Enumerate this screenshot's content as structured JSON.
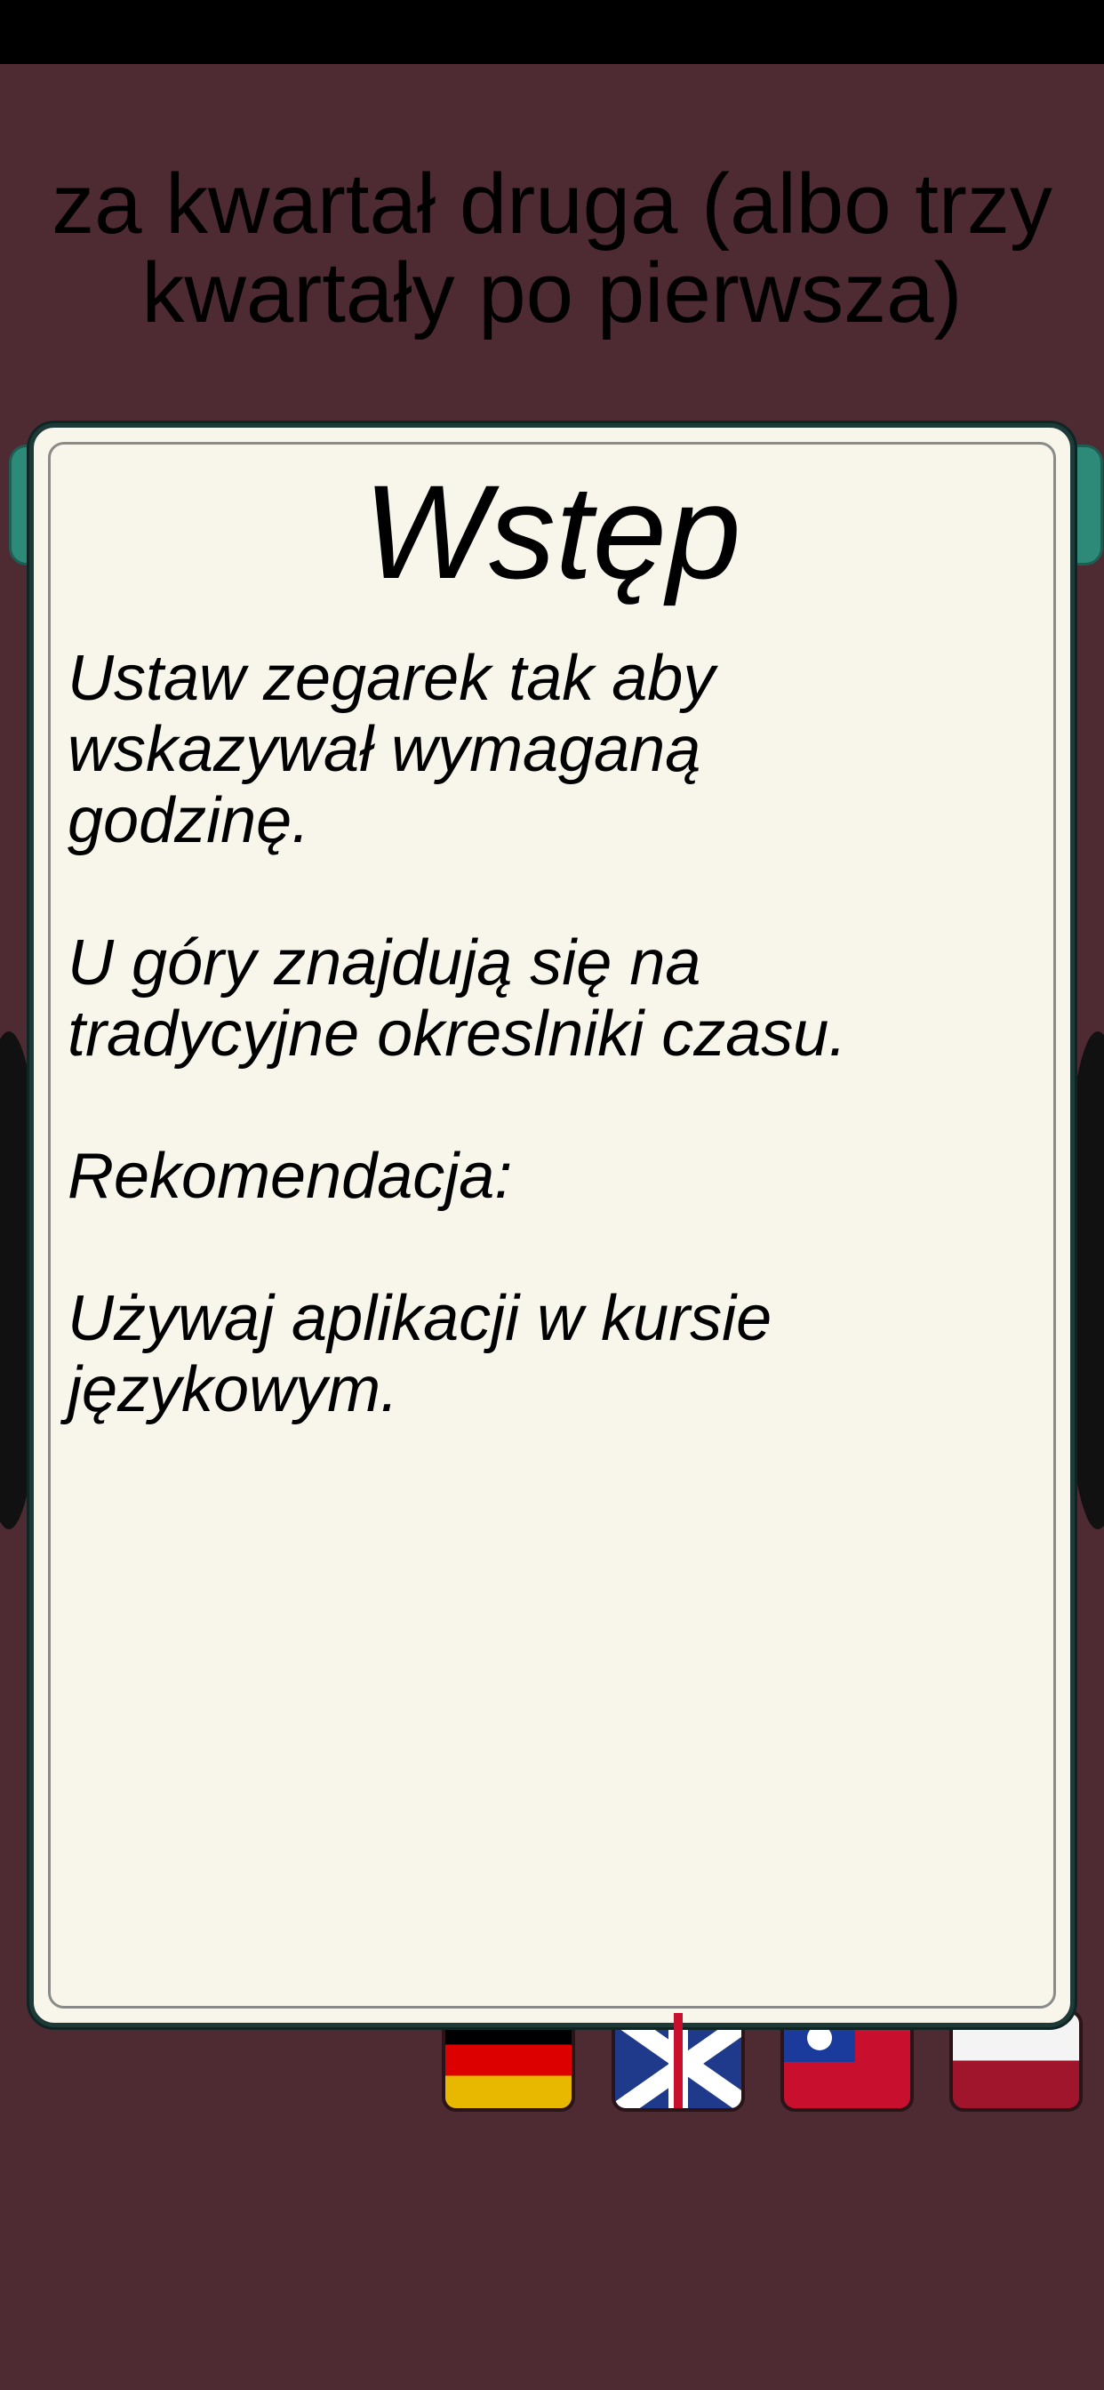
{
  "prompt": {
    "line1": "za kwartał druga (albo trzy",
    "line2": "kwartały po pierwsza)"
  },
  "flags": [
    {
      "name": "German",
      "icon": "german-flag-icon"
    },
    {
      "name": "English",
      "icon": "uk-flag-icon"
    },
    {
      "name": "Taiwanese",
      "icon": "taiwan-flag-icon"
    },
    {
      "name": "Polish",
      "icon": "polish-flag-icon"
    }
  ],
  "modal": {
    "title": "Wstęp",
    "paragraphs": [
      "Ustaw zegarek tak aby\nwskazywał wymaganą\ngodzinę.",
      "U góry znajdują się na\ntradycyjne okreslniki czasu.",
      "Rekomendacja:",
      "Używaj aplikacji w kursie\njęzykowym."
    ]
  },
  "colors": {
    "background": "#4e2a33",
    "modal_bg": "#f8f6ea",
    "modal_border": "#1d3a38",
    "accent_teal": "#2e8a78"
  }
}
